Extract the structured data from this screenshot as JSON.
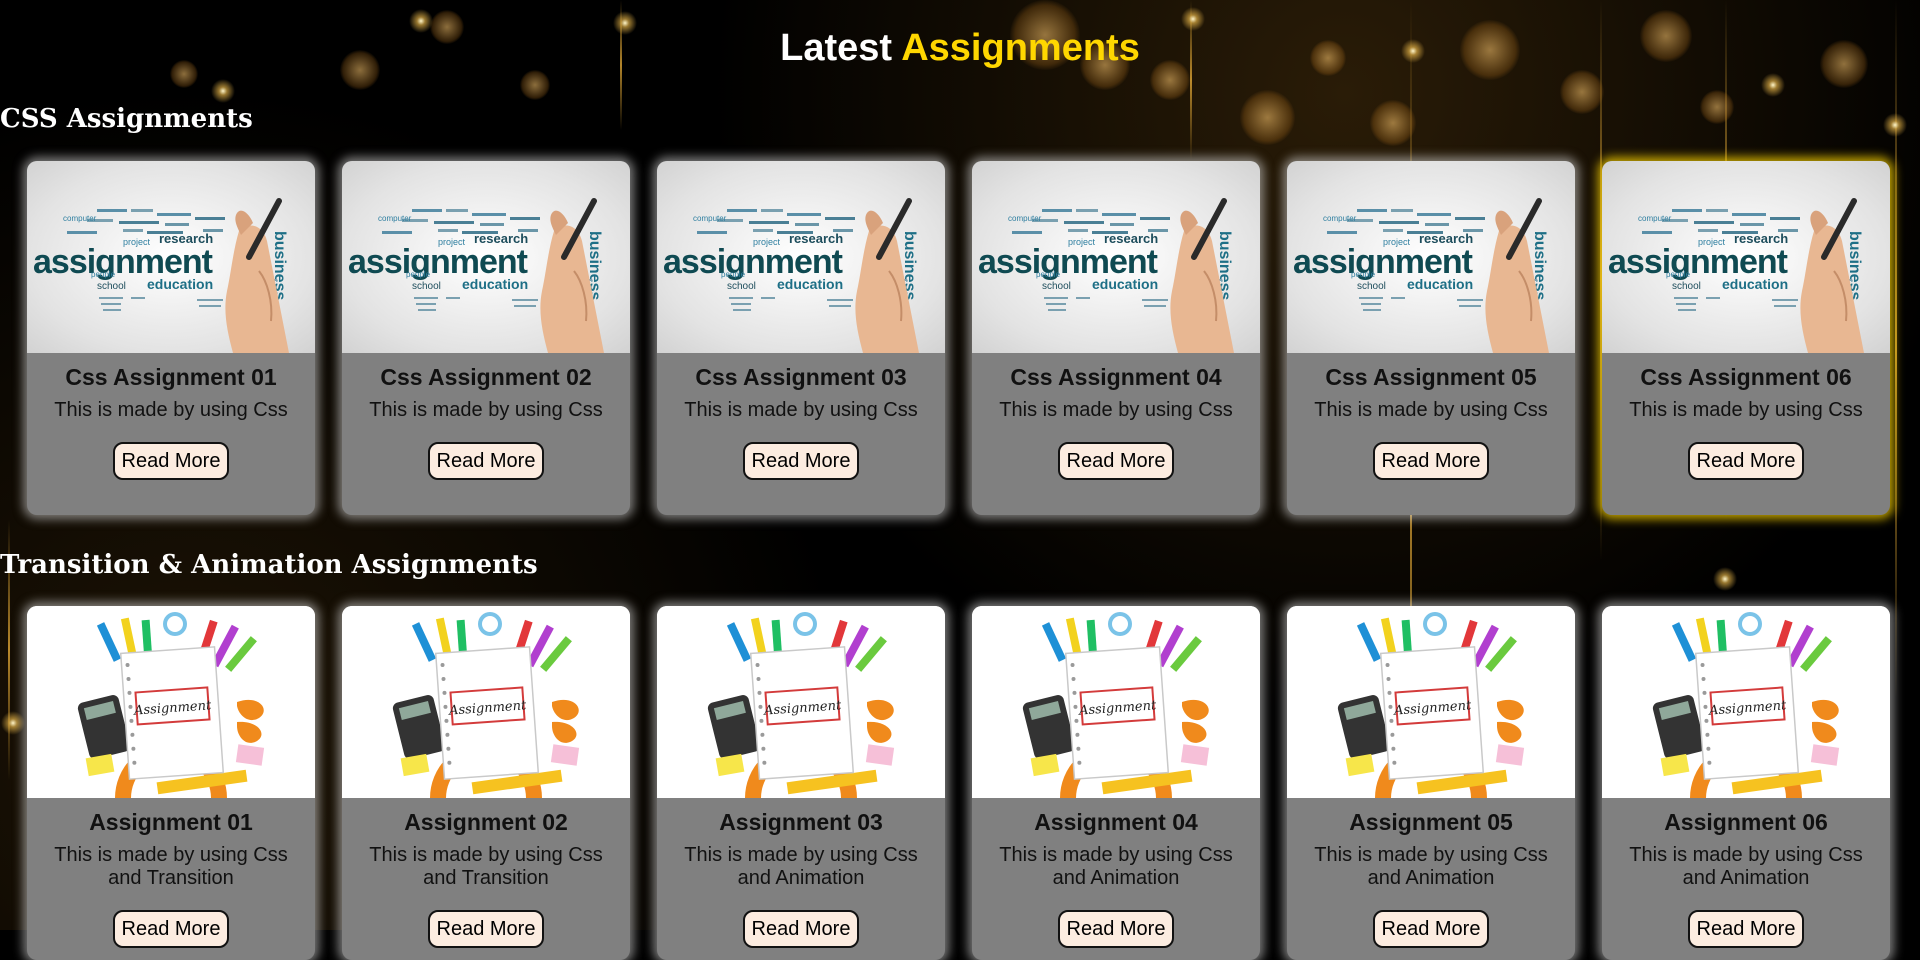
{
  "header": {
    "title_prefix": "Latest",
    "title_accent": "Assignments"
  },
  "colors": {
    "accent": "#ffd700",
    "card_background": "#808080",
    "button_background": "#fcece0",
    "page_background": "#000000"
  },
  "sections": [
    {
      "heading": "CSS Assignments",
      "image_icon": "assignment-word-cloud-image",
      "cards": [
        {
          "title": "Css Assignment 01",
          "description": "This is made by using Css",
          "button": "Read More"
        },
        {
          "title": "Css Assignment 02",
          "description": "This is made by using Css",
          "button": "Read More"
        },
        {
          "title": "Css Assignment 03",
          "description": "This is made by using Css",
          "button": "Read More"
        },
        {
          "title": "Css Assignment 04",
          "description": "This is made by using Css",
          "button": "Read More"
        },
        {
          "title": "Css Assignment 05",
          "description": "This is made by using Css",
          "button": "Read More"
        },
        {
          "title": "Css Assignment 06",
          "description": "This is made by using Css",
          "button": "Read More"
        }
      ]
    },
    {
      "heading": "Transition & Animation Assignments",
      "image_icon": "assignment-notepad-supplies-image",
      "cards": [
        {
          "title": "Assignment 01",
          "description": "This is made by using Css and Transition",
          "button": "Read More"
        },
        {
          "title": "Assignment 02",
          "description": "This is made by using Css and Transition",
          "button": "Read More"
        },
        {
          "title": "Assignment 03",
          "description": "This is made by using Css and Animation",
          "button": "Read More"
        },
        {
          "title": "Assignment 04",
          "description": "This is made by using Css and Animation",
          "button": "Read More"
        },
        {
          "title": "Assignment 05",
          "description": "This is made by using Css and Animation",
          "button": "Read More"
        },
        {
          "title": "Assignment 06",
          "description": "This is made by using Css and Animation",
          "button": "Read More"
        }
      ]
    }
  ]
}
